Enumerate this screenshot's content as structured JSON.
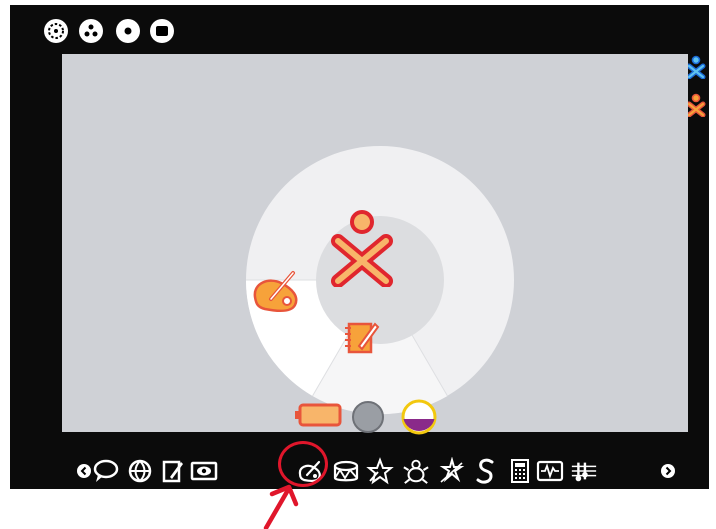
{
  "zoom_buttons": [
    {
      "name": "neighborhood-view-icon"
    },
    {
      "name": "group-view-icon"
    },
    {
      "name": "home-view-icon"
    },
    {
      "name": "activity-view-icon"
    }
  ],
  "buddies": [
    {
      "name": "buddy-icon-blue",
      "stroke": "#1b6ad6",
      "fill": "#5ec2f0"
    },
    {
      "name": "buddy-icon-orange",
      "stroke": "#e8553b",
      "fill": "#f7a23a"
    }
  ],
  "colors": {
    "frame": "#0b0b0b",
    "home_background": "#cfd1d6",
    "ring": "#f0f0f2",
    "center": "#dcdde0",
    "xo_stroke": "#e0262e",
    "xo_fill": "#f8b56a",
    "annotation": "#e0162b"
  },
  "ring_activities": [
    {
      "name": "paint-activity-icon"
    },
    {
      "name": "write-activity-icon"
    }
  ],
  "devices": [
    {
      "name": "battery-icon"
    },
    {
      "name": "network-icon"
    },
    {
      "name": "disk-usage-icon"
    }
  ],
  "frame_bar": {
    "items": [
      {
        "name": "scroll-left-icon"
      },
      {
        "name": "chat-activity-icon"
      },
      {
        "name": "browse-activity-icon"
      },
      {
        "name": "write-activity-icon"
      },
      {
        "name": "record-activity-icon"
      },
      {
        "name": "paint-activity-icon"
      },
      {
        "name": "tamtam-activity-icon"
      },
      {
        "name": "turtleart-activity-icon"
      },
      {
        "name": "etoys-activity-icon"
      },
      {
        "name": "memorize-activity-icon"
      },
      {
        "name": "pippy-activity-icon"
      },
      {
        "name": "calculate-activity-icon"
      },
      {
        "name": "measure-activity-icon"
      },
      {
        "name": "tamtam-edit-activity-icon"
      },
      {
        "name": "scroll-right-icon"
      }
    ]
  }
}
